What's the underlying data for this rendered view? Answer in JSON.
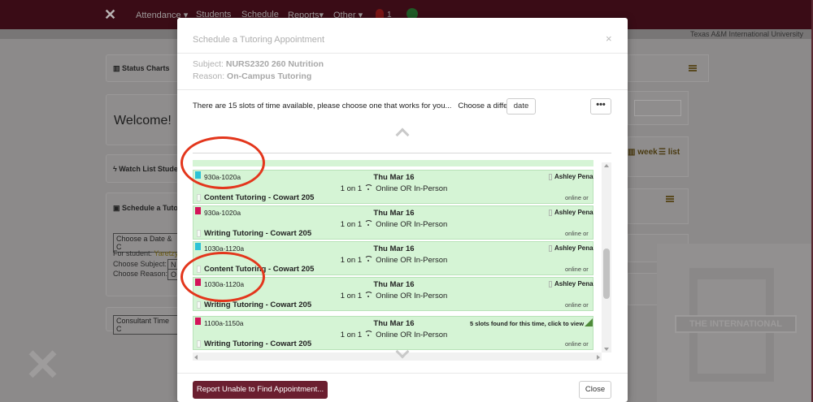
{
  "nav": {
    "items": [
      "Attendance",
      "Students",
      "Schedule",
      "Reports",
      "Other"
    ],
    "notification_count": "1"
  },
  "header": {
    "institution": "Texas A&M International University"
  },
  "background": {
    "status_charts": "Status Charts",
    "welcome": "Welcome!",
    "watch_list": "Watch List Studen",
    "schedule_tutor": "Schedule a Tuto",
    "choose_date": "Choose a Date & C",
    "for_student_label": "For student:",
    "for_student_value": "Yaretzy",
    "choose_subject_label": "Choose Subject:",
    "choose_subject_value": "N",
    "choose_reason_label": "Choose Reason:",
    "choose_reason_value": "O",
    "consultant_time": "Consultant Time C",
    "week_tab": "week",
    "list_tab": "list",
    "watermark_band": "THE INTERNATIONAL"
  },
  "modal": {
    "title": "Schedule a Tutoring Appointment",
    "close_x": "×",
    "subject_label": "Subject:",
    "subject_value": "NURS2320 260 Nutrition",
    "reason_label": "Reason:",
    "reason_value": "On-Campus Tutoring",
    "slots_text": "There are 15 slots of time available, please choose one that works for you...",
    "choose_different": "Choose a different",
    "date_button": "date",
    "more_button": "•••",
    "report_button": "Report Unable to Find Appointment...",
    "close_button": "Close"
  },
  "slots": [
    {
      "time_start": "930a",
      "time_end": "1020a",
      "date": "Thu Mar 16",
      "mode": "1 on 1",
      "delivery": "Online OR In-Person",
      "title": "Content Tutoring - Cowart 205",
      "person": "Ashley Pena",
      "location": "online or",
      "flag_color": "#2dc3d6"
    },
    {
      "time_start": "930a",
      "time_end": "1020a",
      "date": "Thu Mar 16",
      "mode": "1 on 1",
      "delivery": "Online OR In-Person",
      "title": "Writing Tutoring - Cowart 205",
      "person": "Ashley Pena",
      "location": "online or",
      "flag_color": "#d4145a"
    },
    {
      "time_start": "1030a",
      "time_end": "1120a",
      "date": "Thu Mar 16",
      "mode": "1 on 1",
      "delivery": "Online OR In-Person",
      "title": "Content Tutoring - Cowart 205",
      "person": "Ashley Pena",
      "location": "online or",
      "flag_color": "#2dc3d6"
    },
    {
      "time_start": "1030a",
      "time_end": "1120a",
      "date": "Thu Mar 16",
      "mode": "1 on 1",
      "delivery": "Online OR In-Person",
      "title": "Writing Tutoring - Cowart 205",
      "person": "Ashley Pena",
      "location": "online or",
      "flag_color": "#d4145a"
    },
    {
      "time_start": "1100a",
      "time_end": "1150a",
      "date": "Thu Mar 16",
      "mode": "1 on 1",
      "delivery": "Online OR In-Person",
      "title": "Writing Tutoring - Cowart 205",
      "found": "5 slots found for this time, click to view",
      "location": "online or",
      "flag_color": "#d4145a"
    }
  ],
  "colors": {
    "brand": "#3a0c16",
    "slot_bg": "#d5f4d5",
    "report_button": "#6b1f30",
    "annotation": "#e3361c"
  }
}
